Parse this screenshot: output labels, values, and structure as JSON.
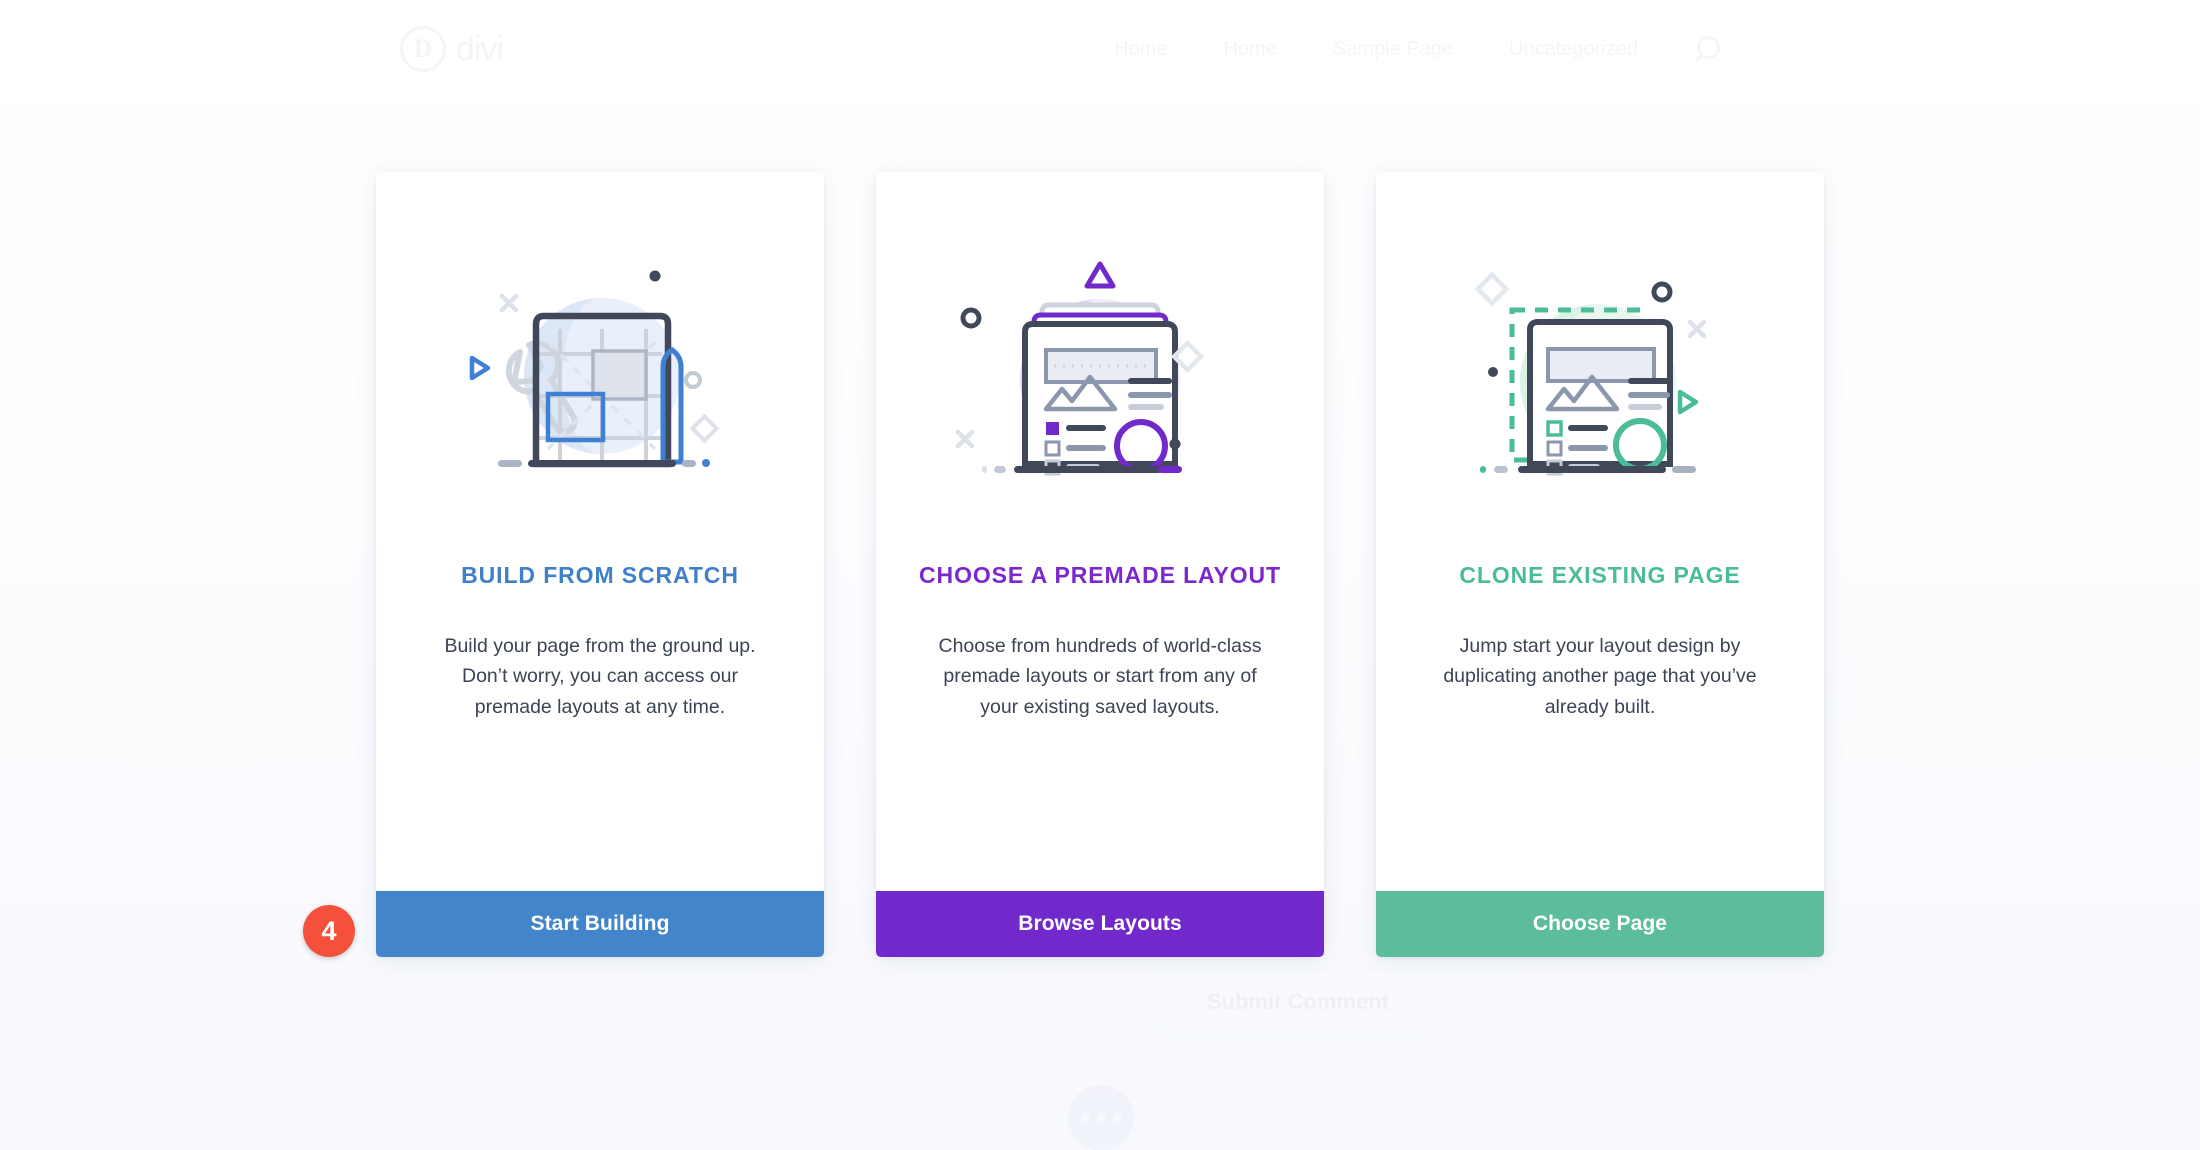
{
  "site": {
    "logo_text": "divi",
    "logo_mark": "D",
    "nav_items": [
      {
        "label": "Home"
      },
      {
        "label": "Home"
      },
      {
        "label": "Sample Page"
      },
      {
        "label": "Uncategorized"
      }
    ],
    "search_icon": "search-icon",
    "submit_comment_label": "Submit Comment",
    "floating_menu_icon": "ellipsis-icon"
  },
  "step_badge": {
    "number": "4",
    "color": "#f4503c"
  },
  "cards": [
    {
      "id": "build-from-scratch",
      "title": "BUILD FROM SCRATCH",
      "description": "Build your page from the ground up. Don’t worry, you can access our premade layouts at any time.",
      "button_label": "Start Building",
      "accent_color": "#3f80c9",
      "button_color": "#4285ca",
      "illustration": "wireframe-grid-pencil-illustration"
    },
    {
      "id": "choose-premade-layout",
      "title": "CHOOSE A PREMADE LAYOUT",
      "description": "Choose from hundreds of world-class premade layouts or start from any of your existing saved layouts.",
      "button_label": "Browse Layouts",
      "accent_color": "#7b29cf",
      "button_color": "#7229cb",
      "illustration": "stacked-layout-pages-illustration"
    },
    {
      "id": "clone-existing-page",
      "title": "CLONE EXISTING PAGE",
      "description": "Jump start your layout design by duplicating another page that you’ve already built.",
      "button_label": "Choose Page",
      "accent_color": "#4bbd96",
      "button_color": "#5cbd9d",
      "illustration": "duplicate-page-dashed-outline-illustration"
    }
  ]
}
